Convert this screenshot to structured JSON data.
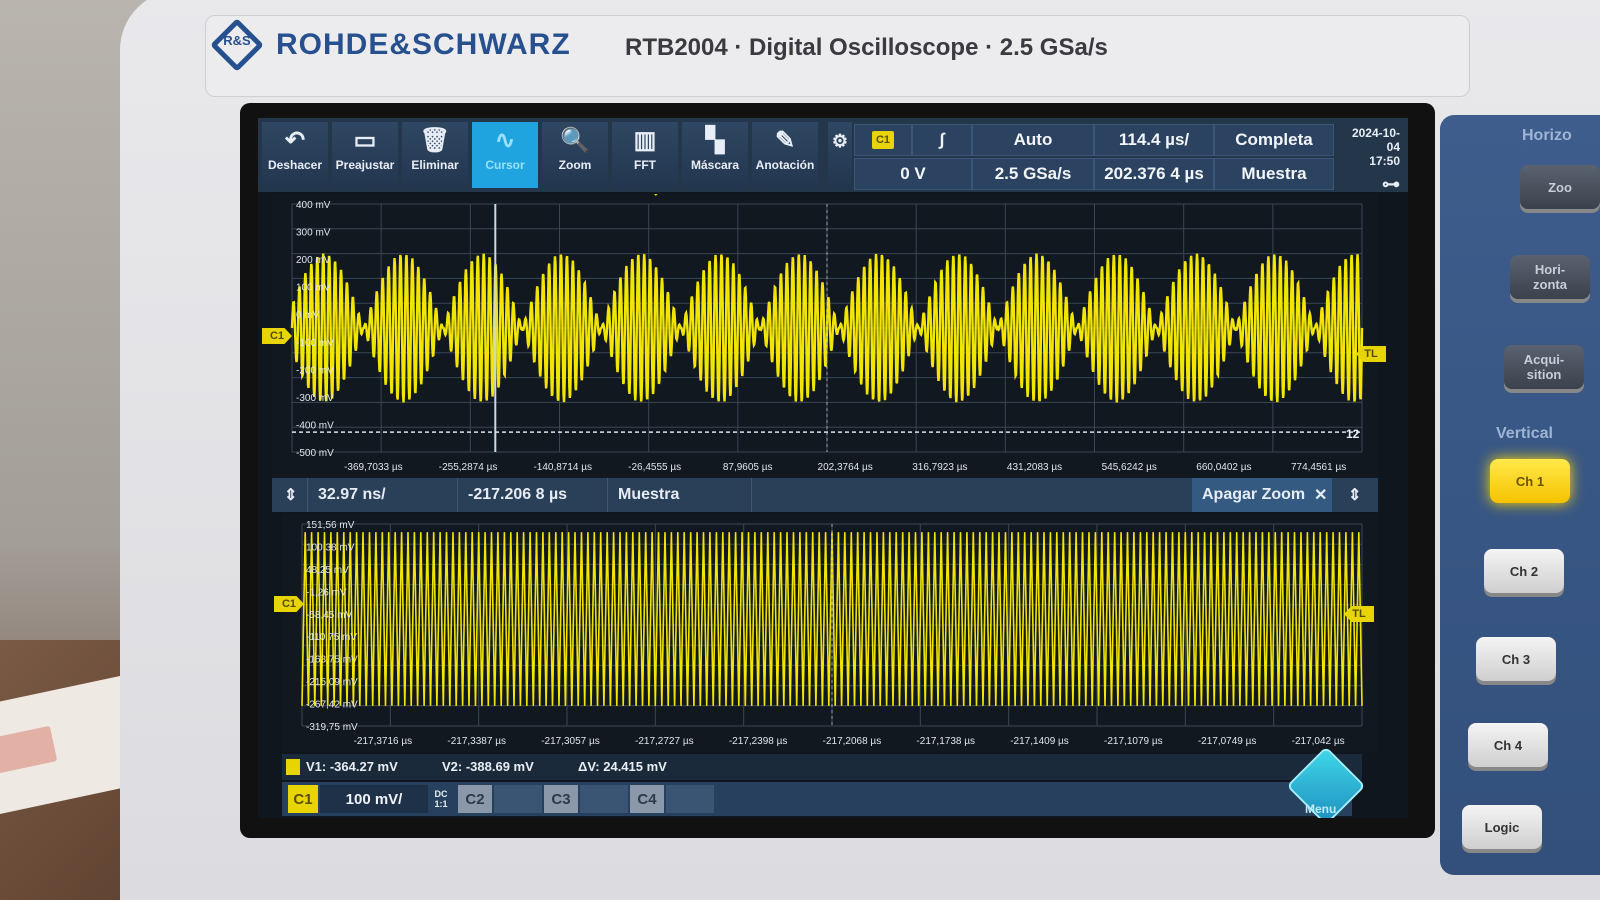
{
  "device": {
    "brand": "ROHDE&SCHWARZ",
    "logo_letters": "R&S",
    "model": "RTB2004 · Digital Oscilloscope · 2.5 GSa/s"
  },
  "toolbar": {
    "tools": [
      {
        "label": "Deshacer",
        "icon": "undo-icon",
        "glyph": "↶"
      },
      {
        "label": "Preajustar",
        "icon": "preset-icon",
        "glyph": "▭"
      },
      {
        "label": "Eliminar",
        "icon": "trash-icon",
        "glyph": "🗑"
      },
      {
        "label": "Cursor",
        "icon": "cursor-wave-icon",
        "glyph": "∿"
      },
      {
        "label": "Zoom",
        "icon": "zoom-icon",
        "glyph": "🔍"
      },
      {
        "label": "FFT",
        "icon": "fft-icon",
        "glyph": "▥"
      },
      {
        "label": "Máscara",
        "icon": "mask-icon",
        "glyph": "▚"
      },
      {
        "label": "Anotación",
        "icon": "pencil-icon",
        "glyph": "✎"
      }
    ],
    "trigger_channel": "C1",
    "trigger_slope": "∫",
    "trigger_level": "0 V",
    "trigger_mode": "Auto",
    "sample_rate": "2.5 GSa/s",
    "timebase": "114.4 µs/",
    "position": "202.376 4 µs",
    "acq_mode": "Completa",
    "acq_type": "Muestra",
    "date": "2024-10-04",
    "time": "17:50"
  },
  "main_plot": {
    "y_ticks": [
      "400 mV",
      "300 mV",
      "200 mV",
      "100 mV",
      "0 mV",
      "-100 mV",
      "-200 mV",
      "-300 mV",
      "-400 mV",
      "-500 mV"
    ],
    "x_ticks": [
      "-369,7033 µs",
      "-255,2874 µs",
      "-140,8714 µs",
      "-26,4555 µs",
      "87,9605 µs",
      "202,3764 µs",
      "316,7923 µs",
      "431,2083 µs",
      "545,6242 µs",
      "660,0402 µs",
      "774,4561 µs"
    ],
    "channel_marker": "C1",
    "trigger_marker": "TL",
    "cursor_marker": "12"
  },
  "zoom_bar": {
    "timebase": "32.97 ns/",
    "position": "-217.206 8 µs",
    "acq_type": "Muestra",
    "close_label": "Apagar Zoom"
  },
  "zoom_plot": {
    "y_ticks": [
      "151,56 mV",
      "100,38 mV",
      "48,25 mV",
      "-1,26 mV",
      "-58,45 mV",
      "-110,75 mV",
      "-163,75 mV",
      "-215,09 mV",
      "-267,42 mV",
      "-319,75 mV"
    ],
    "x_ticks": [
      "-217,3716 µs",
      "-217,3387 µs",
      "-217,3057 µs",
      "-217,2727 µs",
      "-217,2398 µs",
      "-217,2068 µs",
      "-217,1738 µs",
      "-217,1409 µs",
      "-217,1079 µs",
      "-217,0749 µs",
      "-217,042 µs"
    ],
    "channel_marker": "C1",
    "trigger_marker": "TL"
  },
  "cursor_readout": {
    "v1": "V1: -364.27 mV",
    "v2": "V2: -388.69 mV",
    "dv": "ΔV: 24.415 mV"
  },
  "channel_bar": {
    "c1_label": "C1",
    "c1_scale": "100 mV/",
    "c1_coupling": "DC",
    "c1_ratio": "1:1",
    "c2_label": "C2",
    "c3_label": "C3",
    "c4_label": "C4",
    "menu_label": "Menu"
  },
  "side_panel": {
    "horizontal_header": "Horizo",
    "zoom_button": "Zoo",
    "horizontal_button": "Hori-\nzonta",
    "acquisition_button": "Acqui-\nsition",
    "vertical_header": "Vertical",
    "channels": [
      "Ch 1",
      "Ch 2",
      "Ch 3",
      "Ch 4"
    ],
    "logic_button": "Logic"
  },
  "colors": {
    "trace": "#f2e600",
    "accent": "#1fa4e0",
    "brand": "#27508f",
    "panel": "#243649"
  }
}
